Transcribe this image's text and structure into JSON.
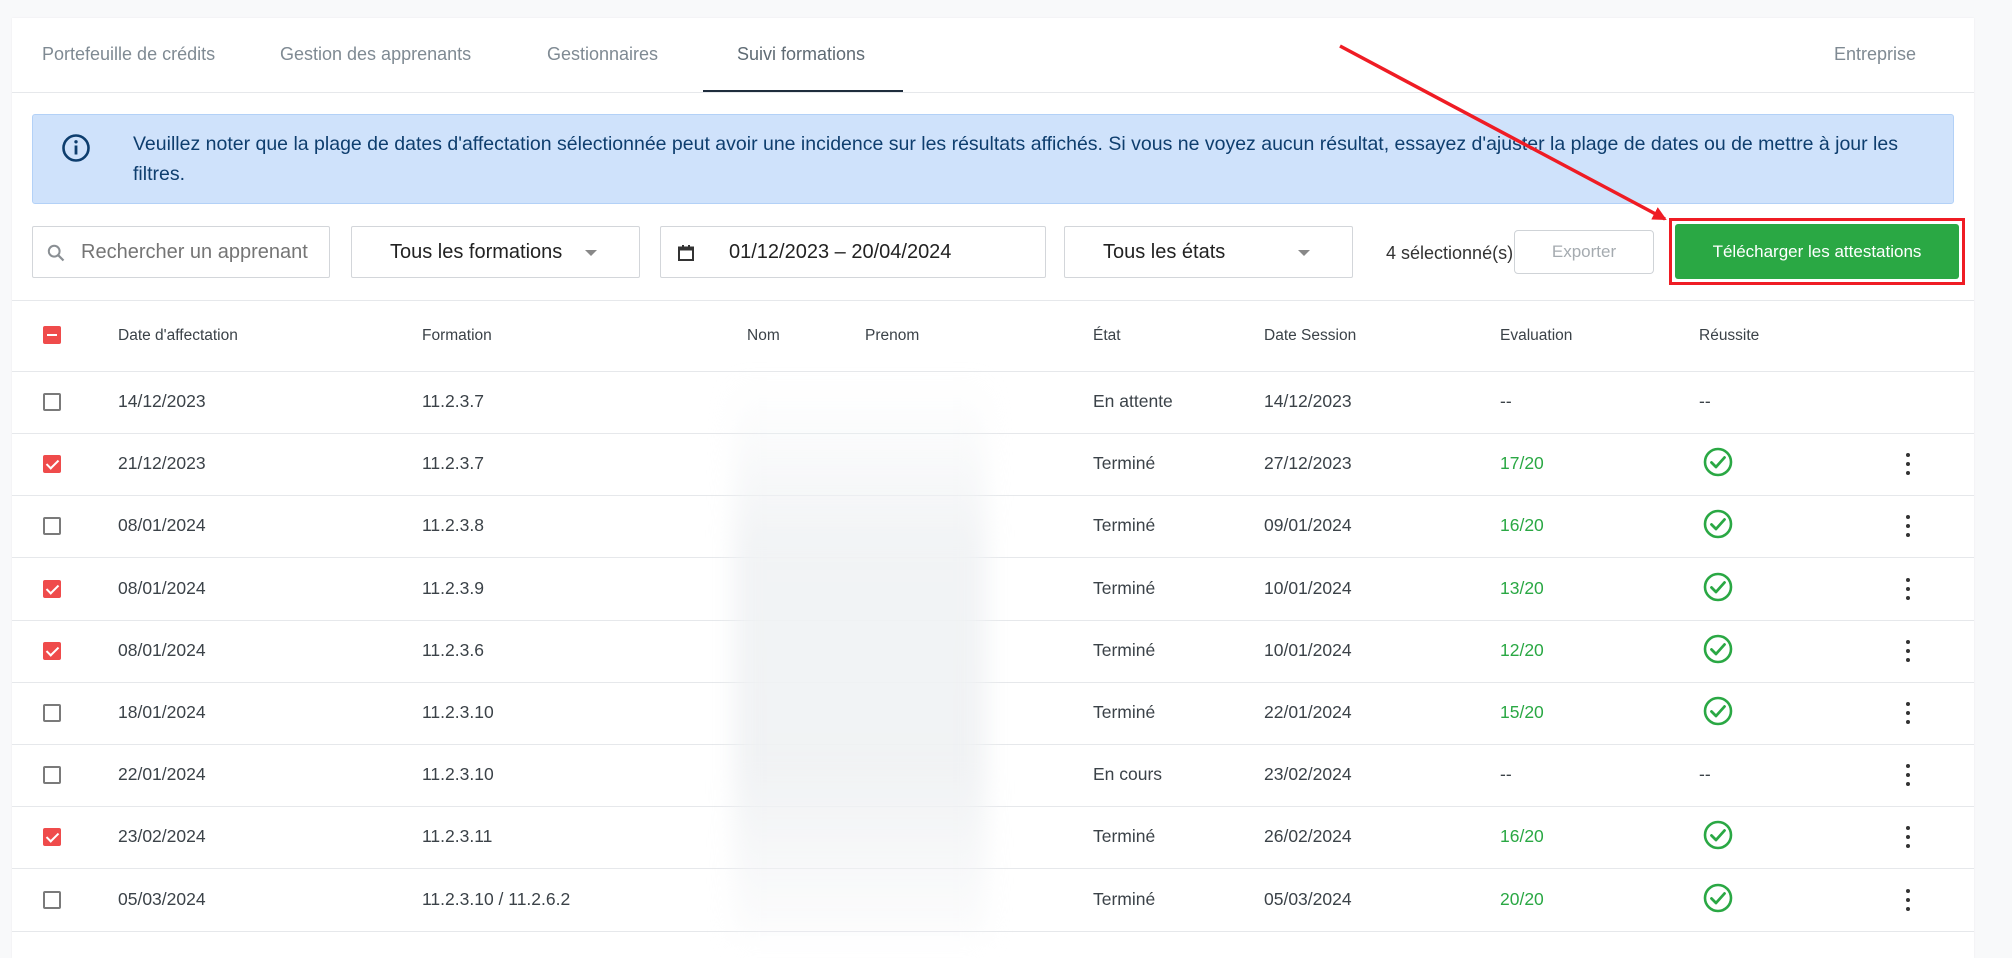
{
  "tabs": [
    {
      "label": "Portefeuille de crédits"
    },
    {
      "label": "Gestion des apprenants"
    },
    {
      "label": "Gestionnaires"
    },
    {
      "label": "Suivi formations"
    },
    {
      "label": "Entreprise"
    }
  ],
  "active_tab": "Suivi formations",
  "alert": {
    "icon": "info-circle-icon",
    "text": "Veuillez noter que la plage de dates d'affectation sélectionnée peut avoir une incidence sur les résultats affichés. Si vous ne voyez aucun résultat, essayez d'ajuster la plage de dates ou de mettre à jour les filtres."
  },
  "filters": {
    "search_placeholder": "Rechercher un apprenant",
    "formation_select": "Tous les formations",
    "date_range": "01/12/2023 – 20/04/2024",
    "state_select": "Tous les états",
    "selected_count": "4 sélectionné(s)",
    "export_label": "Exporter",
    "download_label": "Télécharger les attestations"
  },
  "colors": {
    "accent_red": "#ef4b4b",
    "success_green": "#2aa844",
    "annotation_red": "#ef1c24",
    "alert_bg": "#cfe2fb"
  },
  "table": {
    "headers": {
      "date_affectation": "Date d'affectation",
      "formation": "Formation",
      "nom": "Nom",
      "prenom": "Prenom",
      "etat": "État",
      "date_session": "Date Session",
      "evaluation": "Evaluation",
      "reussite": "Réussite"
    },
    "select_all_state": "indeterminate",
    "rows": [
      {
        "checked": false,
        "date": "14/12/2023",
        "formation": "11.2.3.7",
        "etat": "En attente",
        "date_session": "14/12/2023",
        "evaluation": "--",
        "reussite": "--",
        "passed": false,
        "has_menu": false
      },
      {
        "checked": true,
        "date": "21/12/2023",
        "formation": "11.2.3.7",
        "etat": "Terminé",
        "date_session": "27/12/2023",
        "evaluation": "17/20",
        "reussite": "",
        "passed": true,
        "has_menu": true
      },
      {
        "checked": false,
        "date": "08/01/2024",
        "formation": "11.2.3.8",
        "etat": "Terminé",
        "date_session": "09/01/2024",
        "evaluation": "16/20",
        "reussite": "",
        "passed": true,
        "has_menu": true
      },
      {
        "checked": true,
        "date": "08/01/2024",
        "formation": "11.2.3.9",
        "etat": "Terminé",
        "date_session": "10/01/2024",
        "evaluation": "13/20",
        "reussite": "",
        "passed": true,
        "has_menu": true
      },
      {
        "checked": true,
        "date": "08/01/2024",
        "formation": "11.2.3.6",
        "etat": "Terminé",
        "date_session": "10/01/2024",
        "evaluation": "12/20",
        "reussite": "",
        "passed": true,
        "has_menu": true
      },
      {
        "checked": false,
        "date": "18/01/2024",
        "formation": "11.2.3.10",
        "etat": "Terminé",
        "date_session": "22/01/2024",
        "evaluation": "15/20",
        "reussite": "",
        "passed": true,
        "has_menu": true
      },
      {
        "checked": false,
        "date": "22/01/2024",
        "formation": "11.2.3.10",
        "etat": "En cours",
        "date_session": "23/02/2024",
        "evaluation": "--",
        "reussite": "--",
        "passed": false,
        "has_menu": true
      },
      {
        "checked": true,
        "date": "23/02/2024",
        "formation": "11.2.3.11",
        "etat": "Terminé",
        "date_session": "26/02/2024",
        "evaluation": "16/20",
        "reussite": "",
        "passed": true,
        "has_menu": true
      },
      {
        "checked": false,
        "date": "05/03/2024",
        "formation": "11.2.3.10 / 11.2.6.2",
        "etat": "Terminé",
        "date_session": "05/03/2024",
        "evaluation": "20/20",
        "reussite": "",
        "passed": true,
        "has_menu": true
      }
    ]
  }
}
